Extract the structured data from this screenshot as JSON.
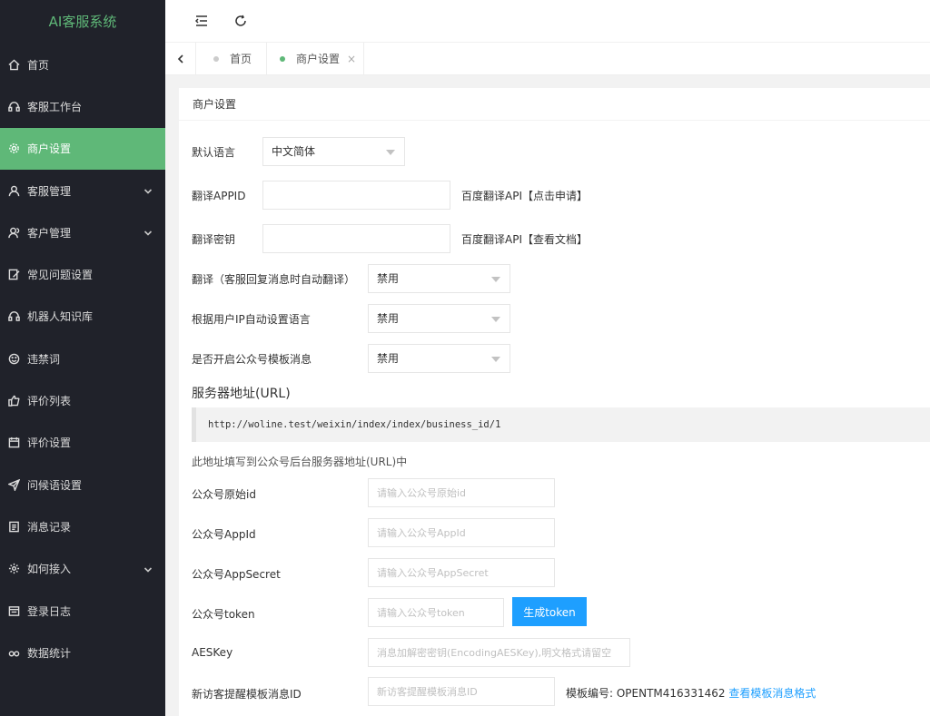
{
  "app": {
    "title": "AI客服系统"
  },
  "sidebar": {
    "items": [
      {
        "label": "首页",
        "icon": "home-icon",
        "active": false,
        "expandable": false
      },
      {
        "label": "客服工作台",
        "icon": "headset-icon",
        "active": false,
        "expandable": false
      },
      {
        "label": "商户设置",
        "icon": "gear-icon",
        "active": true,
        "expandable": false
      },
      {
        "label": "客服管理",
        "icon": "user-icon",
        "active": false,
        "expandable": true
      },
      {
        "label": "客户管理",
        "icon": "users-icon",
        "active": false,
        "expandable": true
      },
      {
        "label": "常见问题设置",
        "icon": "edit-icon",
        "active": false,
        "expandable": false
      },
      {
        "label": "机器人知识库",
        "icon": "headset-icon",
        "active": false,
        "expandable": false
      },
      {
        "label": "违禁词",
        "icon": "smile-icon",
        "active": false,
        "expandable": false
      },
      {
        "label": "评价列表",
        "icon": "thumbs-up-icon",
        "active": false,
        "expandable": false
      },
      {
        "label": "评价设置",
        "icon": "calendar-icon",
        "active": false,
        "expandable": false
      },
      {
        "label": "问候语设置",
        "icon": "send-icon",
        "active": false,
        "expandable": false
      },
      {
        "label": "消息记录",
        "icon": "list-icon",
        "active": false,
        "expandable": false
      },
      {
        "label": "如何接入",
        "icon": "settings-icon",
        "active": false,
        "expandable": true
      },
      {
        "label": "登录日志",
        "icon": "log-icon",
        "active": false,
        "expandable": false
      },
      {
        "label": "数据统计",
        "icon": "link-icon",
        "active": false,
        "expandable": false
      }
    ]
  },
  "tabs": [
    {
      "label": "首页",
      "active": false
    },
    {
      "label": "商户设置",
      "active": true,
      "close": "×"
    }
  ],
  "card": {
    "title": "商户设置"
  },
  "form": {
    "default_language": {
      "label": "默认语言",
      "value": "中文简体"
    },
    "translate_appid": {
      "label": "翻译APPID",
      "value": "",
      "hint": "百度翻译API【点击申请】"
    },
    "translate_key": {
      "label": "翻译密钥",
      "value": "",
      "hint": "百度翻译API【查看文档】"
    },
    "auto_translate": {
      "label": "翻译（客服回复消息时自动翻译）",
      "value": "禁用"
    },
    "ip_language": {
      "label": "根据用户IP自动设置语言",
      "value": "禁用"
    },
    "mp_template": {
      "label": "是否开启公众号模板消息",
      "value": "禁用"
    },
    "server_url": {
      "heading": "服务器地址(URL)",
      "value": "http://woline.test/weixin/index/index/business_id/1",
      "note": "此地址填写到公众号后台服务器地址(URL)中"
    },
    "mp_original_id": {
      "label": "公众号原始id",
      "placeholder": "请输入公众号原始id"
    },
    "mp_appid": {
      "label": "公众号AppId",
      "placeholder": "请输入公众号AppId"
    },
    "mp_appsecret": {
      "label": "公众号AppSecret",
      "placeholder": "请输入公众号AppSecret"
    },
    "mp_token": {
      "label": "公众号token",
      "placeholder": "请输入公众号token",
      "button": "生成token"
    },
    "aes_key": {
      "label": "AESKey",
      "placeholder": "消息加解密密钥(EncodingAESKey),明文格式请留空"
    },
    "visitor_template": {
      "label": "新访客提醒模板消息ID",
      "placeholder": "新访客提醒模板消息ID",
      "hint_prefix": "模板编号: OPENTM416331462",
      "hint_link": "查看模板消息格式"
    }
  },
  "colors": {
    "sidebar_bg": "#20222a",
    "accent": "#5fb878",
    "primary": "#1e9fff"
  }
}
